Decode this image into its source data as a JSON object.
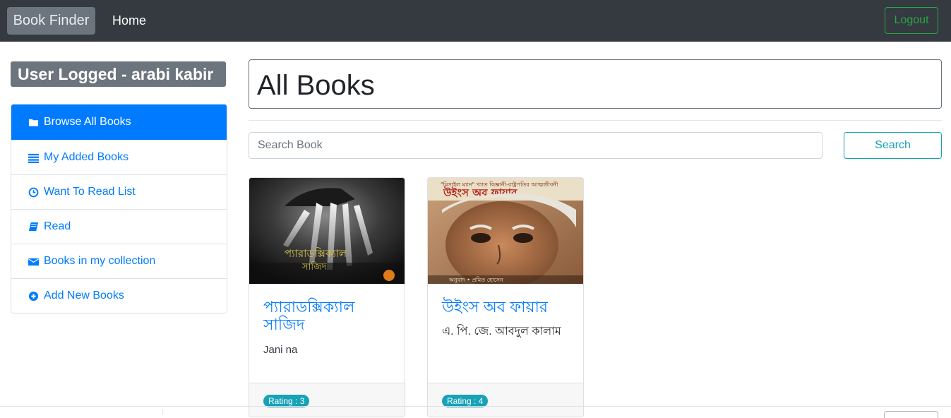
{
  "navbar": {
    "brand": "Book Finder",
    "home": "Home",
    "logout": "Logout"
  },
  "sidebar": {
    "user_badge": "User Logged - arabi kabir",
    "items": [
      {
        "label": "Browse All Books",
        "icon": "folder-icon",
        "active": true
      },
      {
        "label": "My Added Books",
        "icon": "list-icon",
        "active": false
      },
      {
        "label": "Want To Read List",
        "icon": "clock-icon",
        "active": false
      },
      {
        "label": "Read",
        "icon": "book-icon",
        "active": false
      },
      {
        "label": "Books in my collection",
        "icon": "envelope-icon",
        "active": false
      },
      {
        "label": "Add New Books",
        "icon": "plus-circle-icon",
        "active": false
      }
    ]
  },
  "main": {
    "title": "All Books",
    "search": {
      "placeholder": "Search Book",
      "button": "Search"
    },
    "books": [
      {
        "title": "প্যারাডক্সিক্যাল সাজিদ",
        "author": "Jani na",
        "rating": "Rating : 3"
      },
      {
        "title": "উইংস অব ফায়ার",
        "author": "এ. পি. জে. আবদুল কালাম",
        "rating": "Rating : 4"
      }
    ]
  },
  "colors": {
    "navbar": "#343a40",
    "primary": "#007bff",
    "success": "#28a745",
    "info": "#17a2b8",
    "secondary": "#6c757d"
  }
}
